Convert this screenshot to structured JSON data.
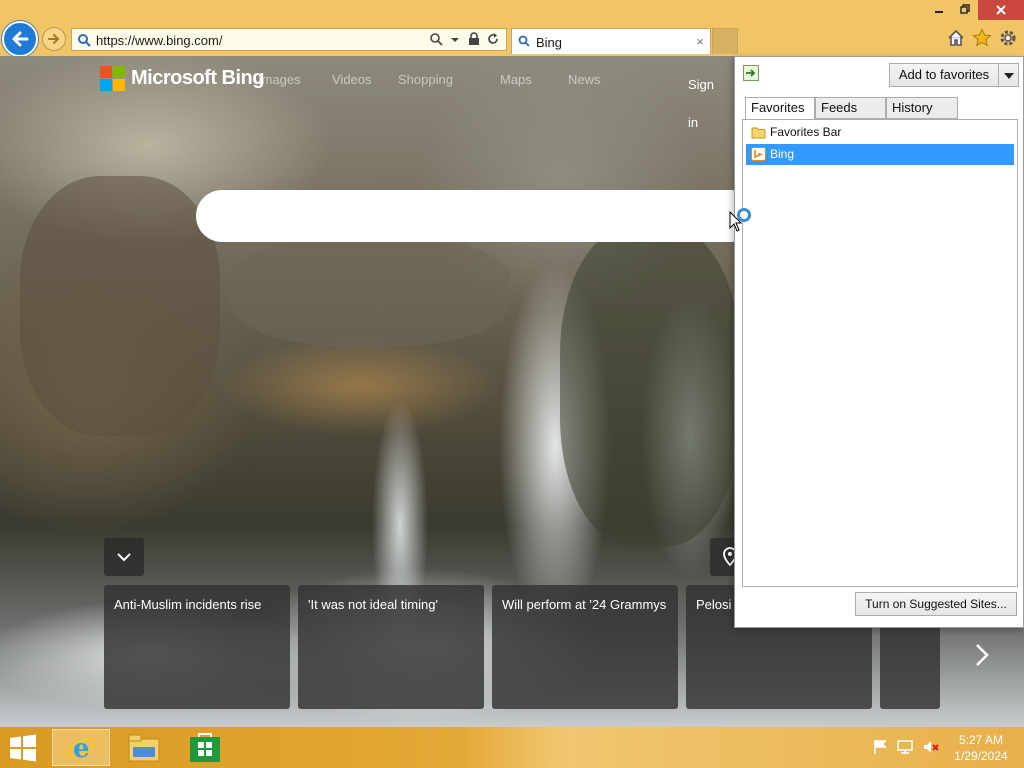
{
  "browser": {
    "address_url": "https://www.bing.com/",
    "tab_title": "Bing",
    "tab_close": "×"
  },
  "bing": {
    "brand": "Microsoft Bing",
    "nav": [
      "Images",
      "Videos",
      "Shopping",
      "Maps",
      "News"
    ],
    "sign_in": "Sign in"
  },
  "news_cards": [
    "Anti-Muslim incidents rise",
    "'It was not ideal timing'",
    "Will perform at '24 Grammys",
    "Pelosi t",
    ""
  ],
  "favorites_panel": {
    "add_button": "Add to favorites",
    "tabs": [
      "Favorites",
      "Feeds",
      "History"
    ],
    "items": [
      {
        "label": "Favorites Bar",
        "icon": "folder-icon",
        "selected": false
      },
      {
        "label": "Bing",
        "icon": "bing-favicon-icon",
        "selected": true
      }
    ],
    "suggested_button": "Turn on Suggested Sites..."
  },
  "taskbar": {
    "time": "5:27 AM",
    "date": "1/29/2024"
  },
  "colors": {
    "chrome": "#f1c566",
    "back_button": "#1e7ad6",
    "selection": "#3399ff",
    "close_button": "#c9473c"
  }
}
